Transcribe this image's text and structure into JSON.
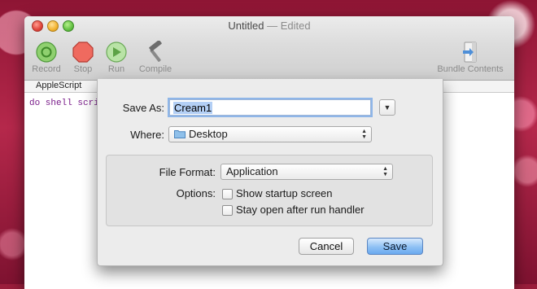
{
  "window": {
    "title": "Untitled",
    "title_suffix": "— Edited"
  },
  "toolbar": {
    "record_label": "Record",
    "stop_label": "Stop",
    "run_label": "Run",
    "compile_label": "Compile",
    "bundle_label": "Bundle Contents"
  },
  "tabbar": {
    "language": "AppleScript"
  },
  "editor": {
    "code": "do shell script \"echo"
  },
  "save_sheet": {
    "save_as_label": "Save As:",
    "save_as_value": "Cream1",
    "expand_icon": "disclosure-down-icon",
    "where_label": "Where:",
    "where_value": "Desktop",
    "file_format_label": "File Format:",
    "file_format_value": "Application",
    "options_label": "Options:",
    "option_startup": "Show startup screen",
    "option_stay_open": "Stay open after run handler",
    "cancel_label": "Cancel",
    "save_label": "Save"
  },
  "colors": {
    "record": "#5bb04a",
    "stop": "#e0443a",
    "run": "#6fbf56",
    "default_button": "#6aa9ef",
    "code_text": "#7a1d8a"
  }
}
